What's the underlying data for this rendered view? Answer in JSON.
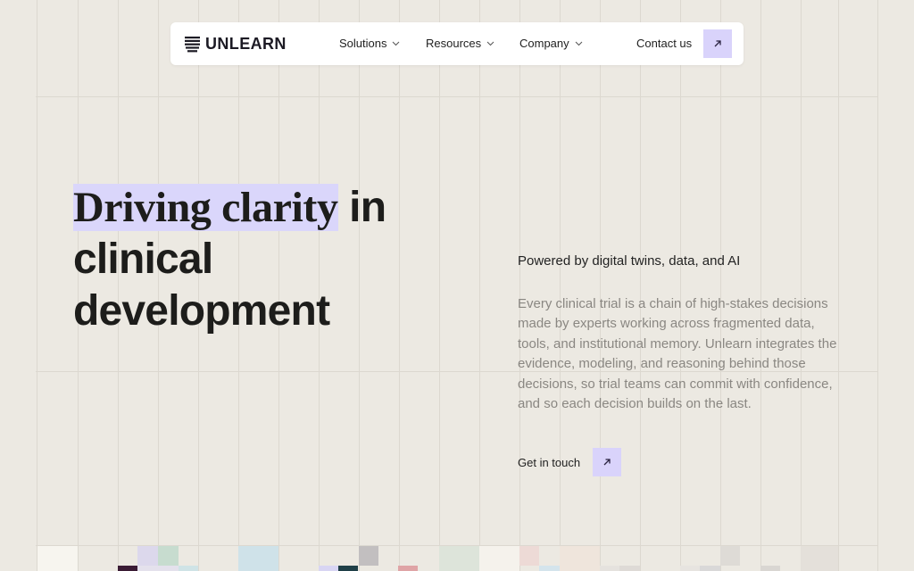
{
  "brand": {
    "name": "UNLEARN",
    "logo_icon": "stacked-bars-logo-icon"
  },
  "nav": {
    "items": [
      {
        "label": "Solutions",
        "icon": "chevron-down-icon"
      },
      {
        "label": "Resources",
        "icon": "chevron-down-icon"
      },
      {
        "label": "Company",
        "icon": "chevron-down-icon"
      }
    ],
    "contact_label": "Contact us",
    "contact_icon": "arrow-up-right-icon"
  },
  "hero": {
    "title_highlight": "Driving clarity",
    "title_rest_1": "in",
    "title_line_2": "clinical",
    "title_line_3": "development",
    "tagline": "Powered by digital twins, data, and AI",
    "description": "Every clinical trial is a chain of high-stakes decisions made by experts working across fragmented data, tools, and institutional memory. Unlearn integrates the evidence, modeling, and reasoning behind those decisions, so trial teams can commit with confidence, and so each decision builds on the last.",
    "cta_label": "Get in touch",
    "cta_icon": "arrow-up-right-icon"
  },
  "colors": {
    "background": "#ece9e2",
    "accent": "#d9d3fb",
    "text": "#1d1d1b",
    "muted_text": "#8a8782"
  }
}
